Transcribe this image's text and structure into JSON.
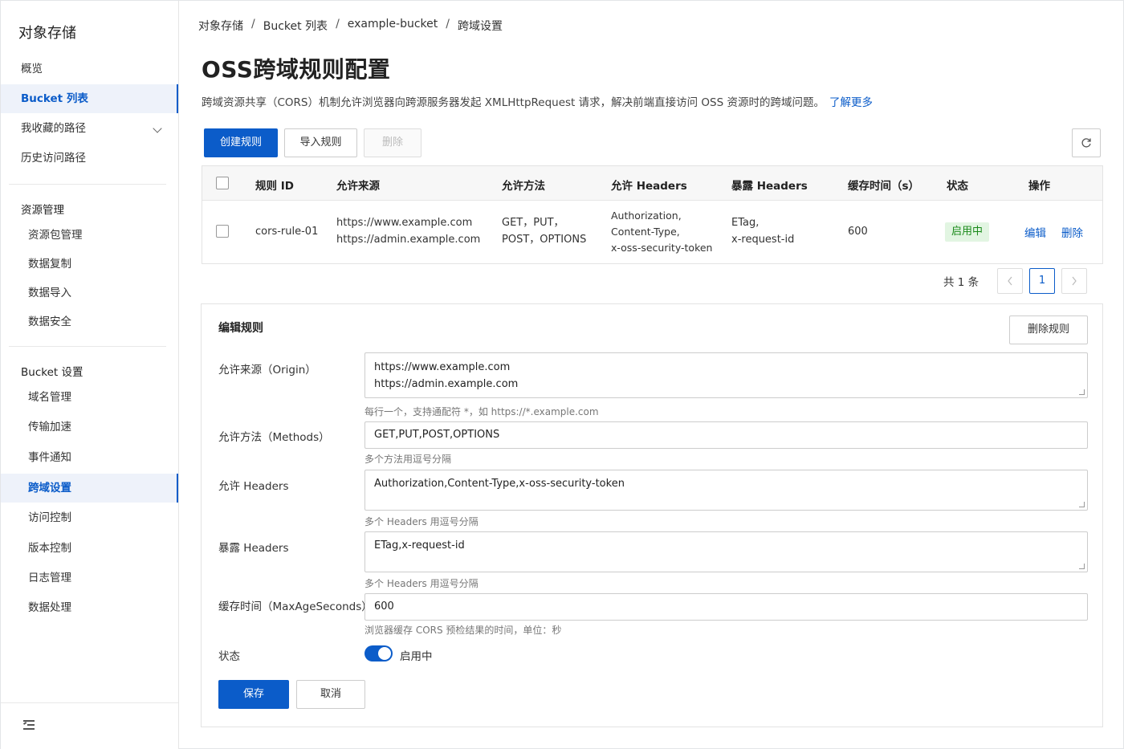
{
  "sidebar": {
    "title": "对象存储",
    "top_items": [
      {
        "label": "概览"
      },
      {
        "label": "Bucket 列表"
      },
      {
        "label": "我收藏的路径"
      },
      {
        "label": "历史访问路径"
      }
    ],
    "group1": {
      "label": "资源管理",
      "items": [
        {
          "label": "资源包管理"
        },
        {
          "label": "数据复制"
        },
        {
          "label": "数据导入"
        },
        {
          "label": "数据安全"
        }
      ]
    },
    "group2": {
      "label": "Bucket 设置",
      "items": [
        {
          "label": "域名管理"
        },
        {
          "label": "传输加速"
        },
        {
          "label": "事件通知"
        },
        {
          "label": "跨域设置"
        },
        {
          "label": "访问控制"
        },
        {
          "label": "版本控制"
        },
        {
          "label": "日志管理"
        },
        {
          "label": "数据处理"
        }
      ]
    },
    "accent": "#0b5cc9"
  },
  "breadcrumb": [
    "对象存储",
    "Bucket 列表",
    "example-bucket",
    "跨域设置"
  ],
  "breadcrumb_sep": "/",
  "page": {
    "title": "OSS跨域规则配置",
    "description": "跨域资源共享（CORS）机制允许浏览器向跨源服务器发起 XMLHttpRequest 请求，解决前端直接访问 OSS 资源时的跨域问题。",
    "learn_more": "了解更多"
  },
  "toolbar": {
    "create": "创建规则",
    "import": "导入规则",
    "delete": "删除"
  },
  "table": {
    "headers": [
      "规则 ID",
      "允许来源",
      "允许方法",
      "允许 Headers",
      "暴露 Headers",
      "缓存时间（s）",
      "状态",
      "操作"
    ],
    "row": {
      "id": "cors-rule-01",
      "origin1": "https://www.example.com",
      "origin2": "https://admin.example.com",
      "methods1": "GET，PUT，",
      "methods2": "POST，OPTIONS",
      "allow_h1": "Authorization,",
      "allow_h2": "Content-Type,",
      "allow_h3": "x-oss-security-token",
      "expose_h1": "ETag,",
      "expose_h2": "x-request-id",
      "cache": "600",
      "status": "启用中",
      "edit": "编辑",
      "delete": "删除"
    }
  },
  "pagination": {
    "total": "共 1 条",
    "current": "1"
  },
  "form": {
    "title": "编辑规则",
    "delete_rule": "删除规则",
    "origin": {
      "label": "允许来源（Origin）",
      "line1": "https://www.example.com",
      "line2": "https://admin.example.com",
      "hint": "每行一个，支持通配符 *，如 https://*.example.com"
    },
    "methods": {
      "label": "允许方法（Methods）",
      "value": "GET,PUT,POST,OPTIONS",
      "hint": "多个方法用逗号分隔"
    },
    "allow_headers": {
      "label": "允许 Headers",
      "value": "Authorization,Content-Type,x-oss-security-token",
      "hint": "多个 Headers 用逗号分隔"
    },
    "expose_headers": {
      "label": "暴露 Headers",
      "value": "ETag,x-request-id",
      "hint": "多个 Headers 用逗号分隔"
    },
    "max_age": {
      "label": "缓存时间（MaxAgeSeconds）",
      "value": "600",
      "hint": "浏览器缓存 CORS 预检结果的时间，单位：秒"
    },
    "status": {
      "label": "状态",
      "value": "启用中",
      "enabled": true
    },
    "save": "保存",
    "cancel": "取消"
  }
}
